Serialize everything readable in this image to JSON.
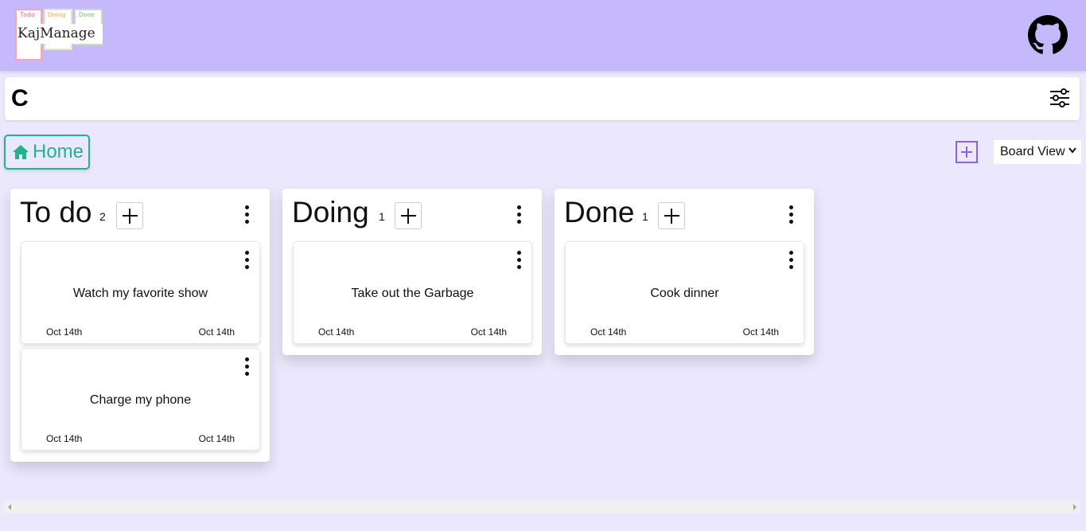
{
  "header": {
    "logo_labels": [
      "Todo",
      "Doing",
      "Done"
    ],
    "logo_title": "KajManage",
    "github_icon": "github-icon"
  },
  "search": {
    "value": "C",
    "filter_icon": "sliders-icon"
  },
  "toolbar": {
    "home_label": "Home",
    "home_icon": "home-icon",
    "add_board_icon": "plus-square-icon",
    "view_selected": "Board View"
  },
  "columns": [
    {
      "title": "To do",
      "count": "2",
      "cards": [
        {
          "text": "Watch my favorite show",
          "date_left": "Oct 14th",
          "date_right": "Oct 14th"
        },
        {
          "text": "Charge my phone",
          "date_left": "Oct 14th",
          "date_right": "Oct 14th"
        }
      ]
    },
    {
      "title": "Doing",
      "count": "1",
      "cards": [
        {
          "text": "Take out the Garbage",
          "date_left": "Oct 14th",
          "date_right": "Oct 14th"
        }
      ]
    },
    {
      "title": "Done",
      "count": "1",
      "cards": [
        {
          "text": "Cook dinner",
          "date_left": "Oct 14th",
          "date_right": "Oct 14th"
        }
      ]
    }
  ],
  "colors": {
    "header_bg": "#c5b8fb",
    "page_bg": "#ebe8fd",
    "accent_green": "#21b38c",
    "accent_purple": "#8f63e0"
  }
}
